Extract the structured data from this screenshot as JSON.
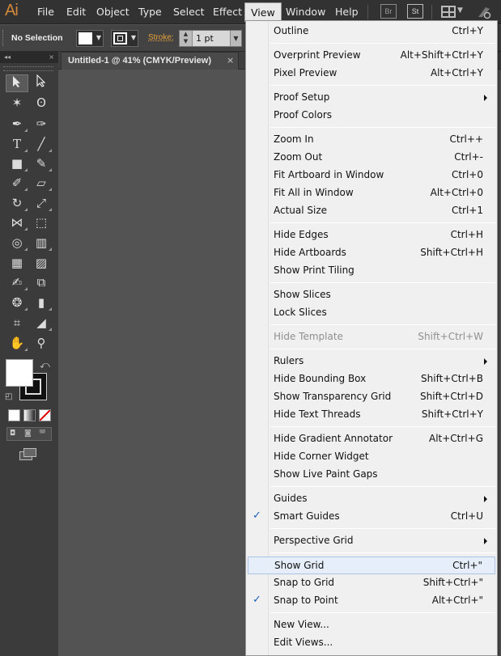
{
  "app": {
    "logo": "Ai",
    "menus": [
      "File",
      "Edit",
      "Object",
      "Type",
      "Select",
      "Effect",
      "View",
      "Window",
      "Help"
    ],
    "bridge_icon": "Br",
    "stock_icon": "St"
  },
  "control_bar": {
    "selection": "No Selection",
    "stroke_label": "Stroke:",
    "stroke_value": "1 pt"
  },
  "document": {
    "tab_title": "Untitled-1 @ 41% (CMYK/Preview)",
    "close": "×"
  },
  "view_menu": {
    "items": [
      {
        "label": "Outline",
        "shortcut": "Ctrl+Y"
      },
      {
        "label": "Overprint Preview",
        "shortcut": "Alt+Shift+Ctrl+Y"
      },
      {
        "label": "Pixel Preview",
        "shortcut": "Alt+Ctrl+Y"
      },
      {
        "label": "Proof Setup",
        "shortcut": ""
      },
      {
        "label": "Proof Colors",
        "shortcut": ""
      },
      {
        "label": "Zoom In",
        "shortcut": "Ctrl++"
      },
      {
        "label": "Zoom Out",
        "shortcut": "Ctrl+-"
      },
      {
        "label": "Fit Artboard in Window",
        "shortcut": "Ctrl+0"
      },
      {
        "label": "Fit All in Window",
        "shortcut": "Alt+Ctrl+0"
      },
      {
        "label": "Actual Size",
        "shortcut": "Ctrl+1"
      },
      {
        "label": "Hide Edges",
        "shortcut": "Ctrl+H"
      },
      {
        "label": "Hide Artboards",
        "shortcut": "Shift+Ctrl+H"
      },
      {
        "label": "Show Print Tiling",
        "shortcut": ""
      },
      {
        "label": "Show Slices",
        "shortcut": ""
      },
      {
        "label": "Lock Slices",
        "shortcut": ""
      },
      {
        "label": "Hide Template",
        "shortcut": "Shift+Ctrl+W"
      },
      {
        "label": "Rulers",
        "shortcut": ""
      },
      {
        "label": "Hide Bounding Box",
        "shortcut": "Shift+Ctrl+B"
      },
      {
        "label": "Show Transparency Grid",
        "shortcut": "Shift+Ctrl+D"
      },
      {
        "label": "Hide Text Threads",
        "shortcut": "Shift+Ctrl+Y"
      },
      {
        "label": "Hide Gradient Annotator",
        "shortcut": "Alt+Ctrl+G"
      },
      {
        "label": "Hide Corner Widget",
        "shortcut": ""
      },
      {
        "label": "Show Live Paint Gaps",
        "shortcut": ""
      },
      {
        "label": "Guides",
        "shortcut": ""
      },
      {
        "label": "Smart Guides",
        "shortcut": "Ctrl+U"
      },
      {
        "label": "Perspective Grid",
        "shortcut": ""
      },
      {
        "label": "Show Grid",
        "shortcut": "Ctrl+\""
      },
      {
        "label": "Snap to Grid",
        "shortcut": "Shift+Ctrl+\""
      },
      {
        "label": "Snap to Point",
        "shortcut": "Alt+Ctrl+\""
      },
      {
        "label": "New View...",
        "shortcut": ""
      },
      {
        "label": "Edit Views...",
        "shortcut": ""
      }
    ],
    "check_glyph": "✓",
    "disabled_item": "Hide Template",
    "highlighted_item": "Show Grid",
    "checked_items": [
      "Smart Guides",
      "Snap to Point"
    ],
    "submenu_items": [
      "Proof Setup",
      "Rulers",
      "Guides",
      "Perspective Grid"
    ]
  },
  "colors": {
    "menubar": "#323232",
    "control_bar": "#434343",
    "canvas": "#535353",
    "menu_bg": "#f0f0f0",
    "stroke_accent": "#e6a03a",
    "check": "#1a5fb4"
  }
}
